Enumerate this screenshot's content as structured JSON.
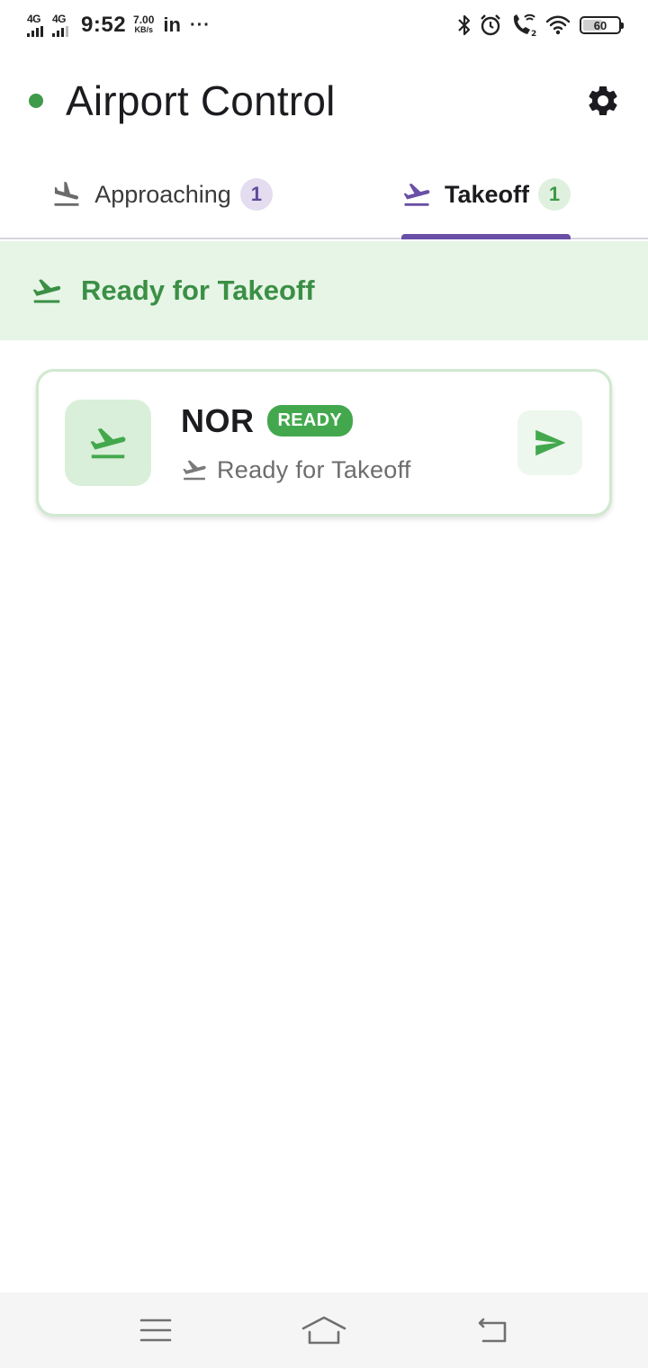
{
  "status_bar": {
    "network_1": "4G",
    "network_2": "4G",
    "time": "9:52",
    "speed_value": "7.00",
    "speed_unit": "KB/s",
    "linkedin": "in",
    "more": "···",
    "battery_level": "60",
    "icons": [
      "bluetooth-icon",
      "alarm-icon",
      "wifi-calling-icon",
      "wifi-icon",
      "battery-icon"
    ]
  },
  "app_bar": {
    "title": "Airport Control",
    "status_dot_color": "#3f9a4a",
    "settings_icon": "gear-icon"
  },
  "tabs": [
    {
      "label": "Approaching",
      "count": "1",
      "icon": "flight-land-icon",
      "selected": false
    },
    {
      "label": "Takeoff",
      "count": "1",
      "icon": "flight-takeoff-icon",
      "selected": true
    }
  ],
  "section": {
    "title": "Ready for Takeoff",
    "icon": "flight-takeoff-icon",
    "color": "#3b8f45"
  },
  "flights": [
    {
      "code": "NOR",
      "badge": "READY",
      "subtitle": "Ready for Takeoff",
      "action_icon": "send-icon"
    }
  ],
  "colors": {
    "accent_purple": "#6a4fa6",
    "green": "#43a84d",
    "banner_bg": "#e6f5e6"
  },
  "nav_bar": {
    "icons": [
      "menu-icon",
      "home-icon",
      "back-icon"
    ]
  }
}
